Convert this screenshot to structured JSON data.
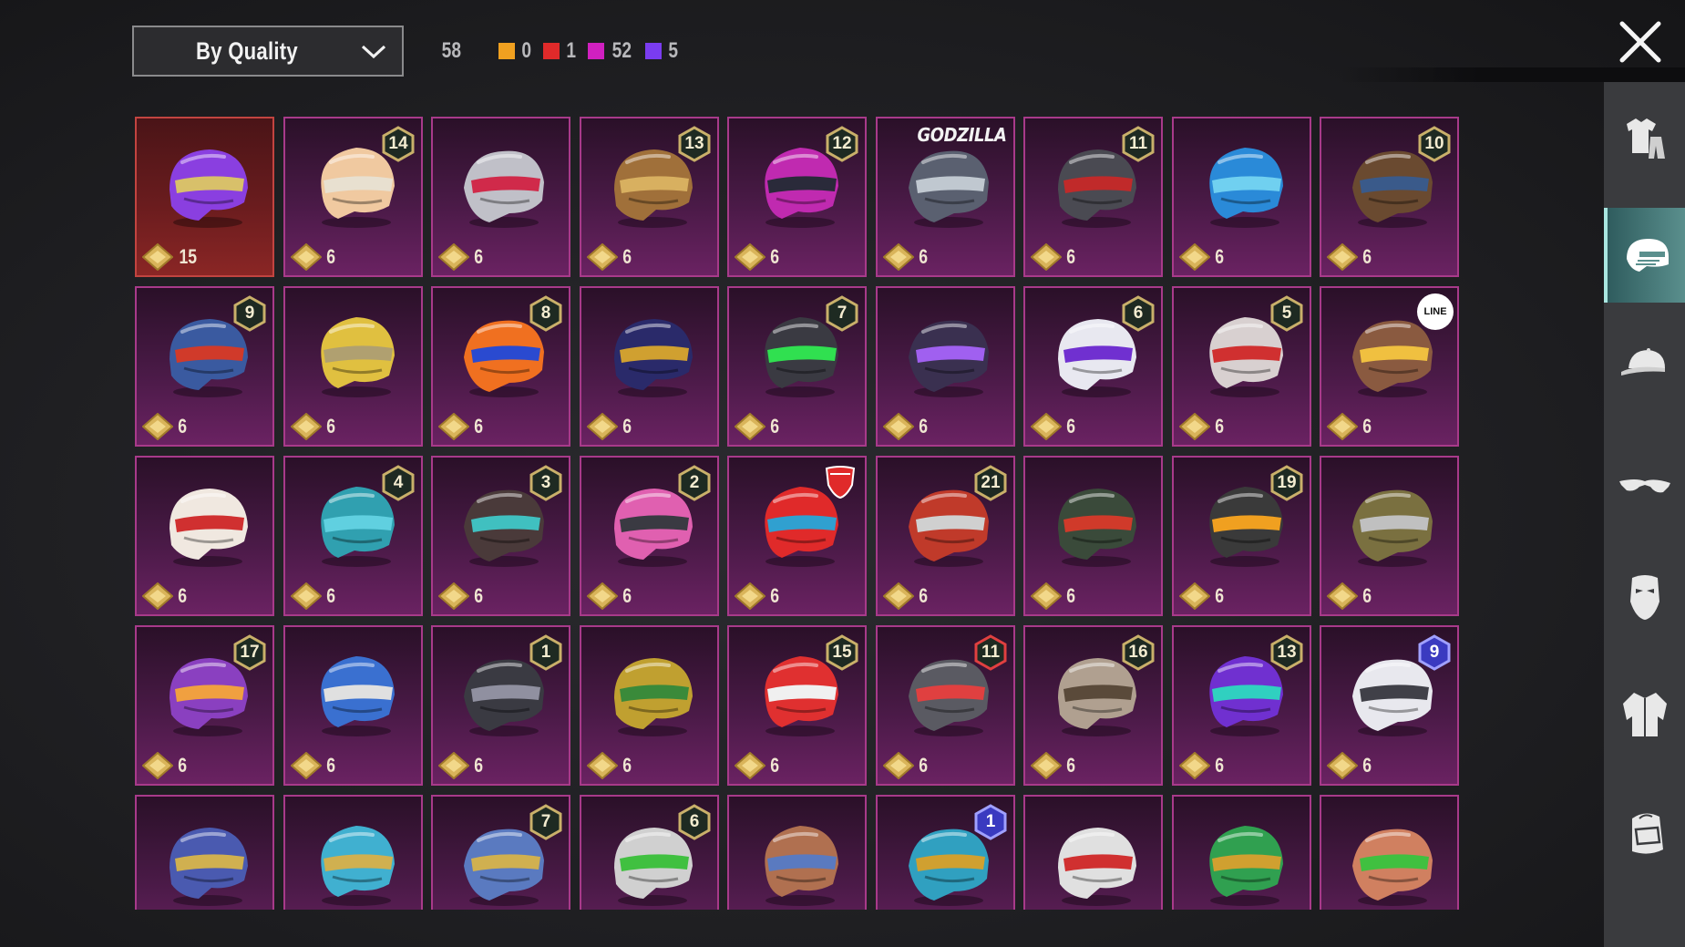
{
  "sort_dropdown": {
    "label": "By Quality"
  },
  "counts": {
    "total": "58",
    "items": [
      {
        "name": "legendary",
        "color": "#f0a020",
        "value": "0"
      },
      {
        "name": "mythic",
        "color": "#e02a2a",
        "value": "1"
      },
      {
        "name": "epic",
        "color": "#d020c0",
        "value": "52"
      },
      {
        "name": "rare",
        "color": "#7a3cf0",
        "value": "5"
      }
    ]
  },
  "colors": {
    "card_border_epic": "#a83a8a",
    "card_border_mythic": "#c24440",
    "sidebar_active": "#5a8f8d",
    "coin": "#d9b45a"
  },
  "sidebar": {
    "items": [
      {
        "icon": "outfit-icon",
        "active": false
      },
      {
        "icon": "helmet-icon",
        "active": true
      },
      {
        "icon": "cap-icon",
        "active": false
      },
      {
        "icon": "glasses-icon",
        "active": false
      },
      {
        "icon": "mask-icon",
        "active": false
      },
      {
        "icon": "jacket-icon",
        "active": false
      },
      {
        "icon": "backpack-icon",
        "active": false
      }
    ]
  },
  "helmets": [
    {
      "qty": "15",
      "badge": "",
      "tag": "",
      "rarity": "mythic",
      "hue": "#8a3fe0",
      "accent": "#d8c06a"
    },
    {
      "qty": "6",
      "badge": "14",
      "tag": "",
      "rarity": "epic",
      "hue": "#f0c9a0",
      "accent": "#e8e0d0"
    },
    {
      "qty": "6",
      "badge": "",
      "tag": "",
      "rarity": "epic",
      "hue": "#c0c0c8",
      "accent": "#d02a4a"
    },
    {
      "qty": "6",
      "badge": "13",
      "tag": "",
      "rarity": "epic",
      "hue": "#a0703a",
      "accent": "#d8b060"
    },
    {
      "qty": "6",
      "badge": "12",
      "tag": "",
      "rarity": "epic",
      "hue": "#c02ab0",
      "accent": "#2a2a3a"
    },
    {
      "qty": "6",
      "badge": "",
      "tag": "GODZILLA",
      "rarity": "epic",
      "hue": "#5a6070",
      "accent": "#c0c8d0"
    },
    {
      "qty": "6",
      "badge": "11",
      "tag": "",
      "rarity": "epic",
      "hue": "#4a4a52",
      "accent": "#c02a2a"
    },
    {
      "qty": "6",
      "badge": "",
      "tag": "",
      "rarity": "epic",
      "hue": "#2a8ad8",
      "accent": "#70d0f0"
    },
    {
      "qty": "6",
      "badge": "10",
      "tag": "",
      "rarity": "epic",
      "hue": "#6a4a30",
      "accent": "#3a5a8a"
    },
    {
      "qty": "6",
      "badge": "9",
      "tag": "",
      "rarity": "epic",
      "hue": "#3a5aa0",
      "accent": "#d03a2a"
    },
    {
      "qty": "6",
      "badge": "",
      "tag": "",
      "rarity": "epic",
      "hue": "#e0c040",
      "accent": "#b0a070"
    },
    {
      "qty": "6",
      "badge": "8",
      "tag": "",
      "rarity": "epic",
      "hue": "#f07020",
      "accent": "#2a4ad0"
    },
    {
      "qty": "6",
      "badge": "",
      "tag": "",
      "rarity": "epic",
      "hue": "#2a2a6a",
      "accent": "#d0a030"
    },
    {
      "qty": "6",
      "badge": "7",
      "tag": "",
      "rarity": "epic",
      "hue": "#3a3a42",
      "accent": "#30e050"
    },
    {
      "qty": "6",
      "badge": "",
      "tag": "",
      "rarity": "epic",
      "hue": "#3a3050",
      "accent": "#a060f0"
    },
    {
      "qty": "6",
      "badge": "6",
      "tag": "",
      "rarity": "epic",
      "hue": "#e8e8f0",
      "accent": "#7030d0"
    },
    {
      "qty": "6",
      "badge": "5",
      "tag": "",
      "rarity": "epic",
      "hue": "#d8d0d0",
      "accent": "#d03030"
    },
    {
      "qty": "6",
      "badge": "",
      "tag": "LINE",
      "rarity": "epic",
      "hue": "#8a5a40",
      "accent": "#f0c040"
    },
    {
      "qty": "6",
      "badge": "",
      "tag": "",
      "rarity": "epic",
      "hue": "#f0e8e0",
      "accent": "#d03030"
    },
    {
      "qty": "6",
      "badge": "4",
      "tag": "",
      "rarity": "epic",
      "hue": "#30a0b0",
      "accent": "#60d0e0"
    },
    {
      "qty": "6",
      "badge": "3",
      "tag": "",
      "rarity": "epic",
      "hue": "#4a3a3a",
      "accent": "#40c0c0"
    },
    {
      "qty": "6",
      "badge": "2",
      "tag": "",
      "rarity": "epic",
      "hue": "#e060b0",
      "accent": "#3a3a42"
    },
    {
      "qty": "6",
      "badge": "",
      "tag": "DUCATI",
      "rarity": "epic",
      "hue": "#e02a2a",
      "accent": "#30a0d0"
    },
    {
      "qty": "6",
      "badge": "21",
      "tag": "",
      "rarity": "epic",
      "hue": "#c03a2a",
      "accent": "#d0d0d0"
    },
    {
      "qty": "6",
      "badge": "",
      "tag": "",
      "rarity": "epic",
      "hue": "#3a4a3a",
      "accent": "#d03a2a"
    },
    {
      "qty": "6",
      "badge": "19",
      "tag": "",
      "rarity": "epic",
      "hue": "#3a3a3a",
      "accent": "#f0a020"
    },
    {
      "qty": "6",
      "badge": "",
      "tag": "",
      "rarity": "epic",
      "hue": "#7a7040",
      "accent": "#c0c0c0"
    },
    {
      "qty": "6",
      "badge": "17",
      "tag": "",
      "rarity": "epic",
      "hue": "#8a40c0",
      "accent": "#f0a040"
    },
    {
      "qty": "6",
      "badge": "",
      "tag": "",
      "rarity": "epic",
      "hue": "#3a70d0",
      "accent": "#e0e0e0"
    },
    {
      "qty": "6",
      "badge": "1",
      "tag": "",
      "rarity": "epic",
      "hue": "#3a3a42",
      "accent": "#9090a0"
    },
    {
      "qty": "6",
      "badge": "",
      "tag": "",
      "rarity": "epic",
      "hue": "#c0a030",
      "accent": "#3a8a3a"
    },
    {
      "qty": "6",
      "badge": "15",
      "tag": "",
      "rarity": "epic",
      "hue": "#e03030",
      "accent": "#f0f0f0"
    },
    {
      "qty": "6",
      "badge": "11",
      "tag": "",
      "rarity": "epic",
      "hue": "#5a5a62",
      "accent": "#e04040",
      "badge_style": "red"
    },
    {
      "qty": "6",
      "badge": "16",
      "tag": "",
      "rarity": "epic",
      "hue": "#b0a090",
      "accent": "#5a4a3a"
    },
    {
      "qty": "6",
      "badge": "13",
      "tag": "",
      "rarity": "epic",
      "hue": "#7030d0",
      "accent": "#30d0c0"
    },
    {
      "qty": "6",
      "badge": "9",
      "tag": "",
      "rarity": "epic",
      "hue": "#e8e8ee",
      "accent": "#404048",
      "badge_style": "blue"
    },
    {
      "qty": "",
      "badge": "",
      "tag": "",
      "rarity": "epic",
      "hue": "#4a5ab0",
      "accent": "#d0b050"
    },
    {
      "qty": "",
      "badge": "",
      "tag": "",
      "rarity": "epic",
      "hue": "#40b0d0",
      "accent": "#d0b050"
    },
    {
      "qty": "",
      "badge": "7",
      "tag": "",
      "rarity": "epic",
      "hue": "#5a7ac0",
      "accent": "#d0b050"
    },
    {
      "qty": "",
      "badge": "6",
      "tag": "",
      "rarity": "epic",
      "hue": "#d0d0d0",
      "accent": "#40c040"
    },
    {
      "qty": "",
      "badge": "",
      "tag": "",
      "rarity": "epic",
      "hue": "#b07050",
      "accent": "#5a7ac0"
    },
    {
      "qty": "",
      "badge": "1",
      "tag": "",
      "rarity": "epic",
      "hue": "#30a0c0",
      "accent": "#d0a030",
      "badge_style": "blue"
    },
    {
      "qty": "",
      "badge": "",
      "tag": "",
      "rarity": "epic",
      "hue": "#e0e0e0",
      "accent": "#d03030"
    },
    {
      "qty": "",
      "badge": "",
      "tag": "",
      "rarity": "epic",
      "hue": "#30a050",
      "accent": "#d0a030"
    },
    {
      "qty": "",
      "badge": "",
      "tag": "",
      "rarity": "epic",
      "hue": "#d08060",
      "accent": "#40c040"
    }
  ]
}
